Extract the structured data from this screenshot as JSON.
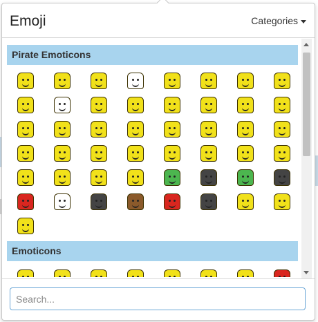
{
  "header": {
    "title": "Emoji",
    "categories_label": "Categories"
  },
  "sections": [
    {
      "name": "Pirate Emoticons"
    },
    {
      "name": "Emoticons"
    }
  ],
  "search": {
    "placeholder": "Search..."
  },
  "icons": {
    "pirate_grid": [
      "angry-lego-face-icon",
      "grumpy-lego-face-icon",
      "smiling-lego-face-icon",
      "skull-face-icon",
      "pirate-with-sword-icon",
      "eyepatch-face-icon",
      "bandana-face-icon",
      "glasses-face-icon",
      "heart-eyes-face-icon",
      "white-face-icon",
      "eyepatch-smile-icon",
      "smile-face-icon",
      "surprised-face-icon",
      "worried-face-icon",
      "blue-hat-pirate-icon",
      "tricorn-pirate-beer-icon",
      "eyepatch-face-icon",
      "sweat-face-icon",
      "sad-face-icon",
      "kiss-face-icon",
      "frown-face-icon",
      "teeth-face-icon",
      "neutral-face-icon",
      "scared-face-icon",
      "crying-face-icon",
      "nervous-face-icon",
      "tearful-face-icon",
      "confused-face-icon",
      "angry-face-icon",
      "grimace-face-icon",
      "mad-face-icon",
      "upset-face-icon",
      "open-mouth-face-icon",
      "shock-face-icon",
      "crying-wet-face-icon",
      "blush-hearts-face-icon",
      "green-zombie-face-icon",
      "black-pirate-hat-icon",
      "green-pirate-face-icon",
      "tricorn-hat-icon",
      "red-devil-icon",
      "skull-crossbones-icon",
      "cannon-icon",
      "monkey-face-icon",
      "parrot-icon",
      "shark-icon",
      "thumbs-up-icon",
      "thumbs-down-icon",
      "thumbs-up-small-icon"
    ],
    "emoticons_grid": [
      "smile-face-icon",
      "smirk-face-icon",
      "dizzy-face-icon",
      "neutral-face-icon",
      "grin-face-icon",
      "grin-wide-face-icon",
      "angry-face-icon",
      "devil-face-icon"
    ]
  }
}
